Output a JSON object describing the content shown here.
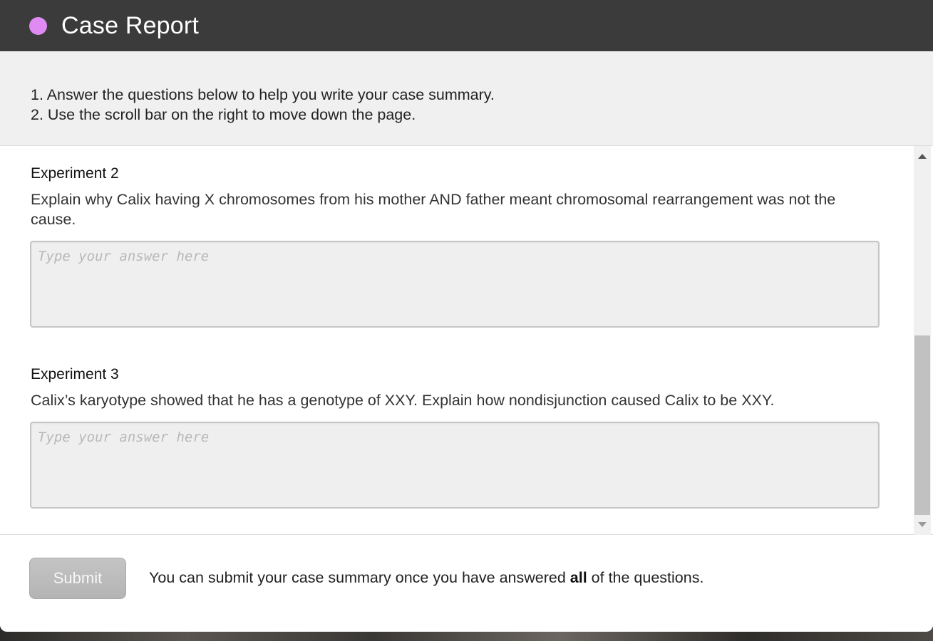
{
  "header": {
    "title": "Case Report",
    "accent_color": "#e08af4"
  },
  "instructions": {
    "line1": "1. Answer the questions below to help you write your case summary.",
    "line2": "2. Use the scroll bar on the right to move down the page."
  },
  "questions": [
    {
      "title": "Experiment 2",
      "text": "Explain why Calix having X chromosomes from his mother AND father meant chromosomal rearrangement was not the cause.",
      "answer_value": "",
      "placeholder": "Type your answer here"
    },
    {
      "title": "Experiment 3",
      "text": "Calix’s karyotype showed that he has a genotype of XXY. Explain how nondisjunction caused Calix to be XXY.",
      "answer_value": "",
      "placeholder": "Type your answer here"
    }
  ],
  "footer": {
    "submit_label": "Submit",
    "note_before": "You can submit your case summary once you have answered ",
    "note_bold": "all",
    "note_after": " of the questions."
  }
}
